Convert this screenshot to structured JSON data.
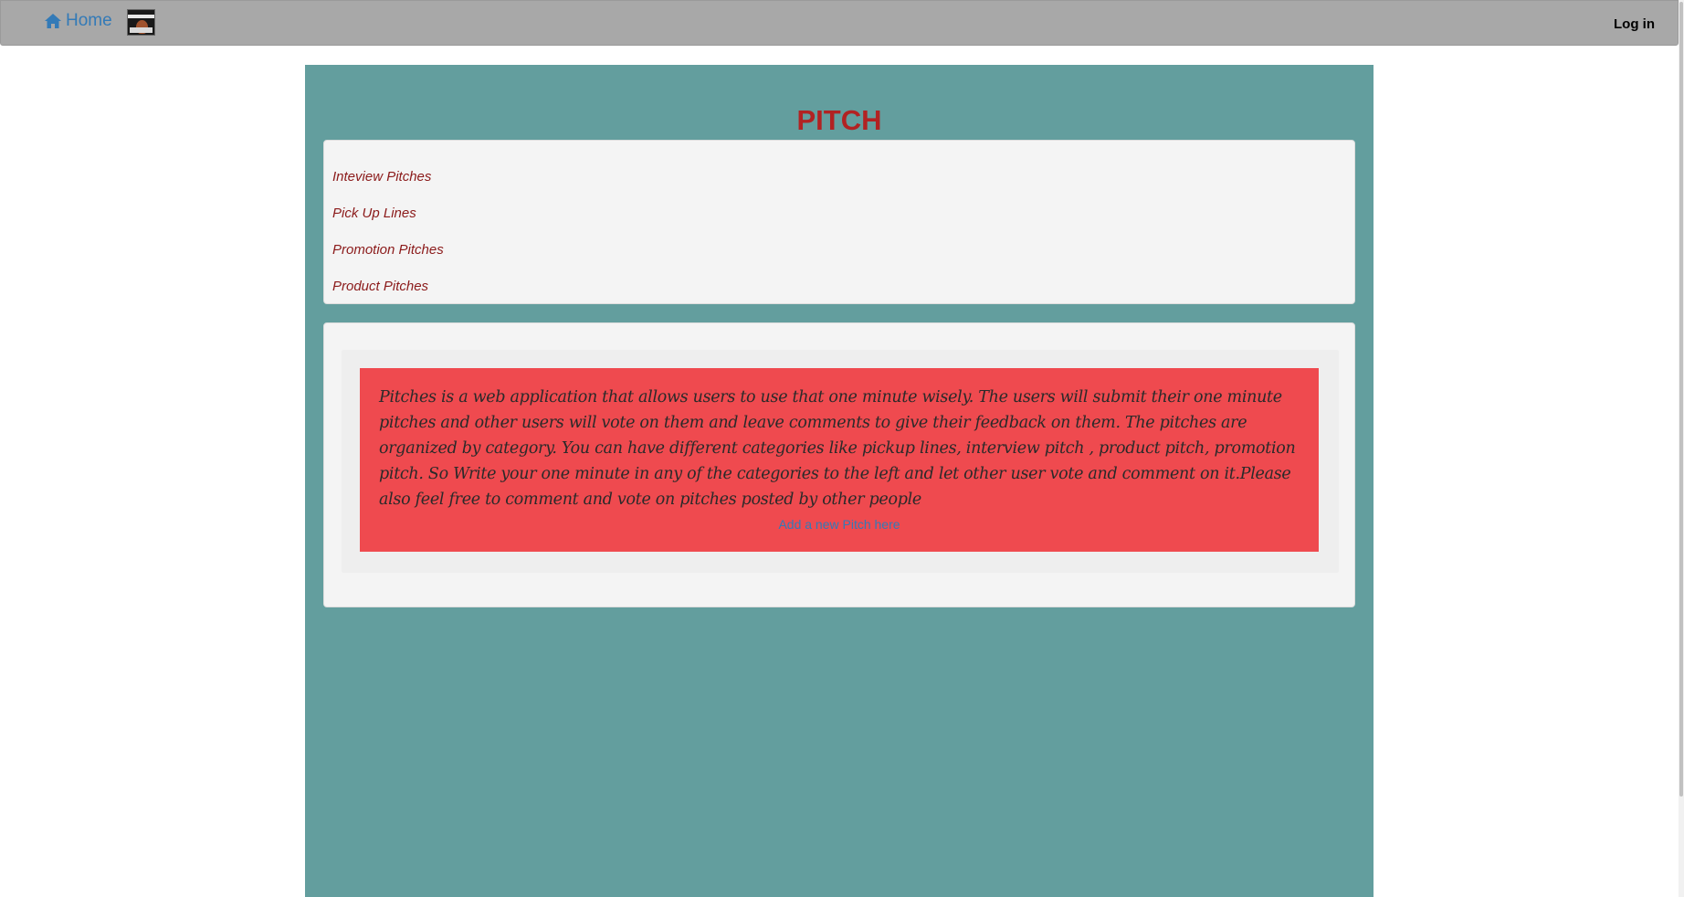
{
  "navbar": {
    "home_label": "Home",
    "home_icon": "home-icon",
    "login_label": "Log in"
  },
  "page": {
    "title": "PITCH"
  },
  "categories": [
    {
      "label": "Inteview Pitches"
    },
    {
      "label": "Pick Up Lines"
    },
    {
      "label": "Promotion Pitches"
    },
    {
      "label": "Product Pitches"
    }
  ],
  "info": {
    "description": "Pitches is a web application that allows users to use that one minute wisely. The users will submit their one minute pitches and other users will vote on them and leave comments to give their feedback on them. The pitches are organized by category. You can have different categories like pickup lines, interview pitch , product pitch, promotion pitch. So Write your one minute in any of the categories to the left and let other user vote and comment on it.Please also feel free to comment and vote on pitches posted by other people",
    "add_link_label": "Add a new Pitch here"
  },
  "colors": {
    "navbar_bg": "#a8a8a8",
    "main_bg": "#639e9e",
    "title": "#b22222",
    "category_link": "#8b1a1a",
    "info_box_bg": "#ef4a4f",
    "link": "#337ab7"
  }
}
